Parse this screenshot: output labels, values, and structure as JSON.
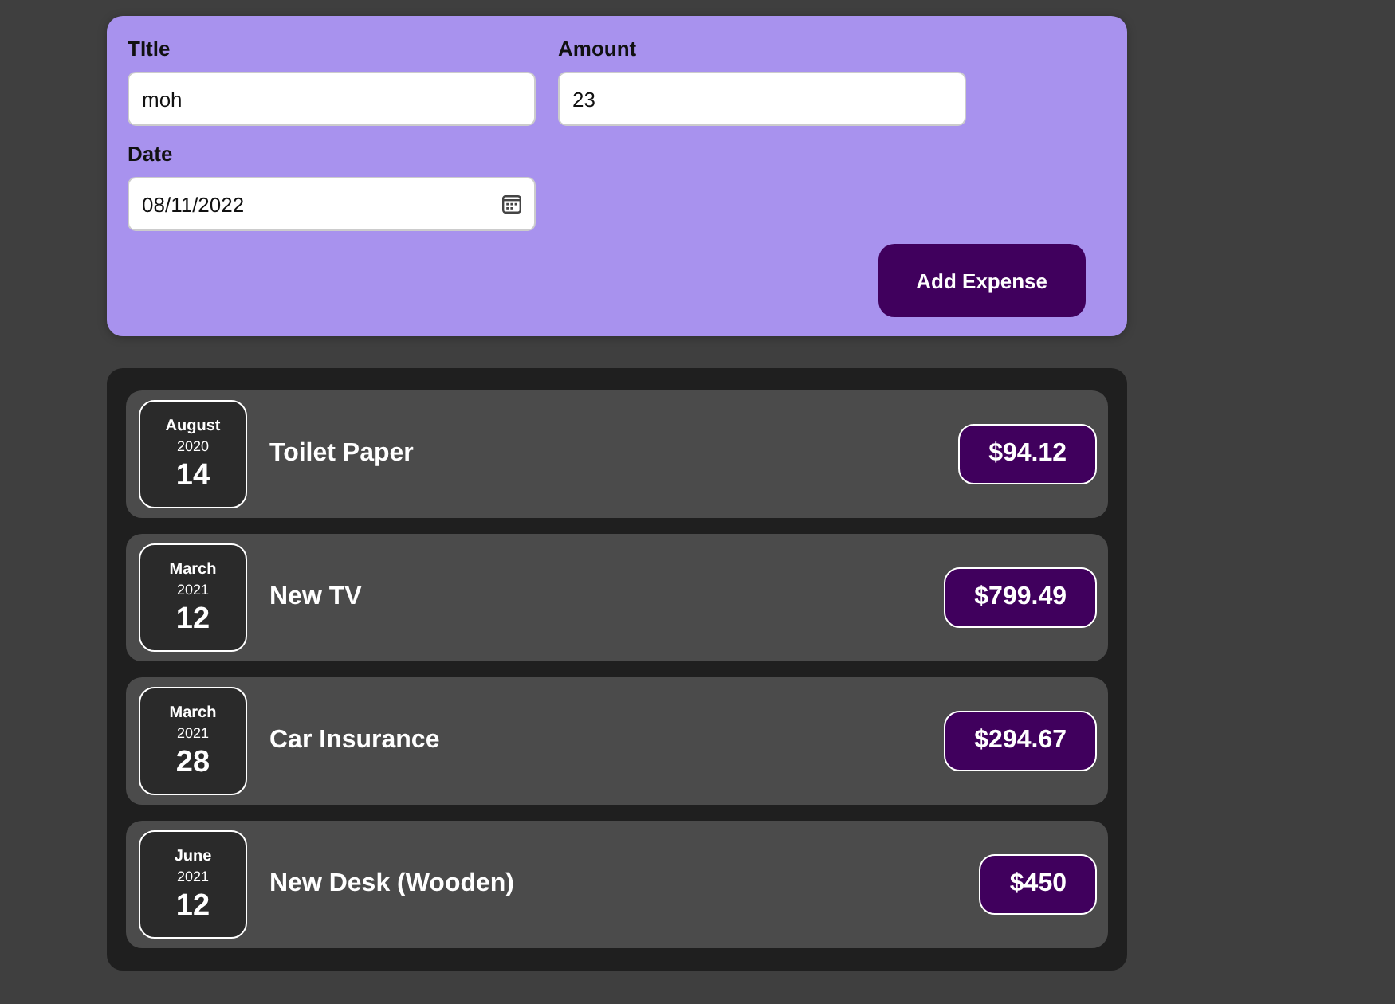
{
  "form": {
    "fields": [
      {
        "label": "TItle",
        "value": "moh",
        "kind": "text"
      },
      {
        "label": "Amount",
        "value": "23",
        "kind": "text"
      },
      {
        "label": "Date",
        "value": "08/11/2022",
        "kind": "date"
      }
    ],
    "submit_button": "Add Expense"
  },
  "expenses": [
    {
      "month": "August",
      "year": "2020",
      "day": "14",
      "title": "Toilet Paper",
      "amount": "$94.12"
    },
    {
      "month": "March",
      "year": "2021",
      "day": "12",
      "title": "New TV",
      "amount": "$799.49"
    },
    {
      "month": "March",
      "year": "2021",
      "day": "28",
      "title": "Car Insurance",
      "amount": "$294.67"
    },
    {
      "month": "June",
      "year": "2021",
      "day": "12",
      "title": "New Desk (Wooden)",
      "amount": "$450"
    }
  ]
}
